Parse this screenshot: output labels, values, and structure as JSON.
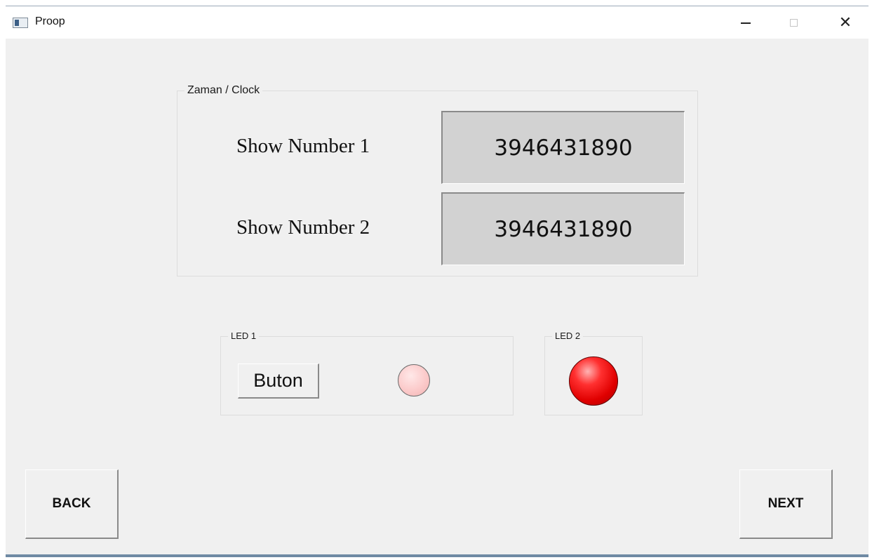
{
  "window": {
    "title": "Proop",
    "icon": "app-window-icon",
    "controls": {
      "minimize_icon": "minimize-icon",
      "maximize_icon": "maximize-icon",
      "close_glyph": "✕"
    }
  },
  "clock_group": {
    "caption": "Zaman / Clock",
    "rows": [
      {
        "label": "Show Number 1",
        "value": "3946431890"
      },
      {
        "label": "Show Number 2",
        "value": "3946431890"
      }
    ]
  },
  "led1_group": {
    "caption": "LED 1",
    "button_label": "Buton",
    "led_state": "off",
    "led_color": "#fbcaca"
  },
  "led2_group": {
    "caption": "LED 2",
    "led_state": "on",
    "led_color": "#e00000"
  },
  "nav": {
    "back_label": "BACK",
    "next_label": "NEXT"
  }
}
